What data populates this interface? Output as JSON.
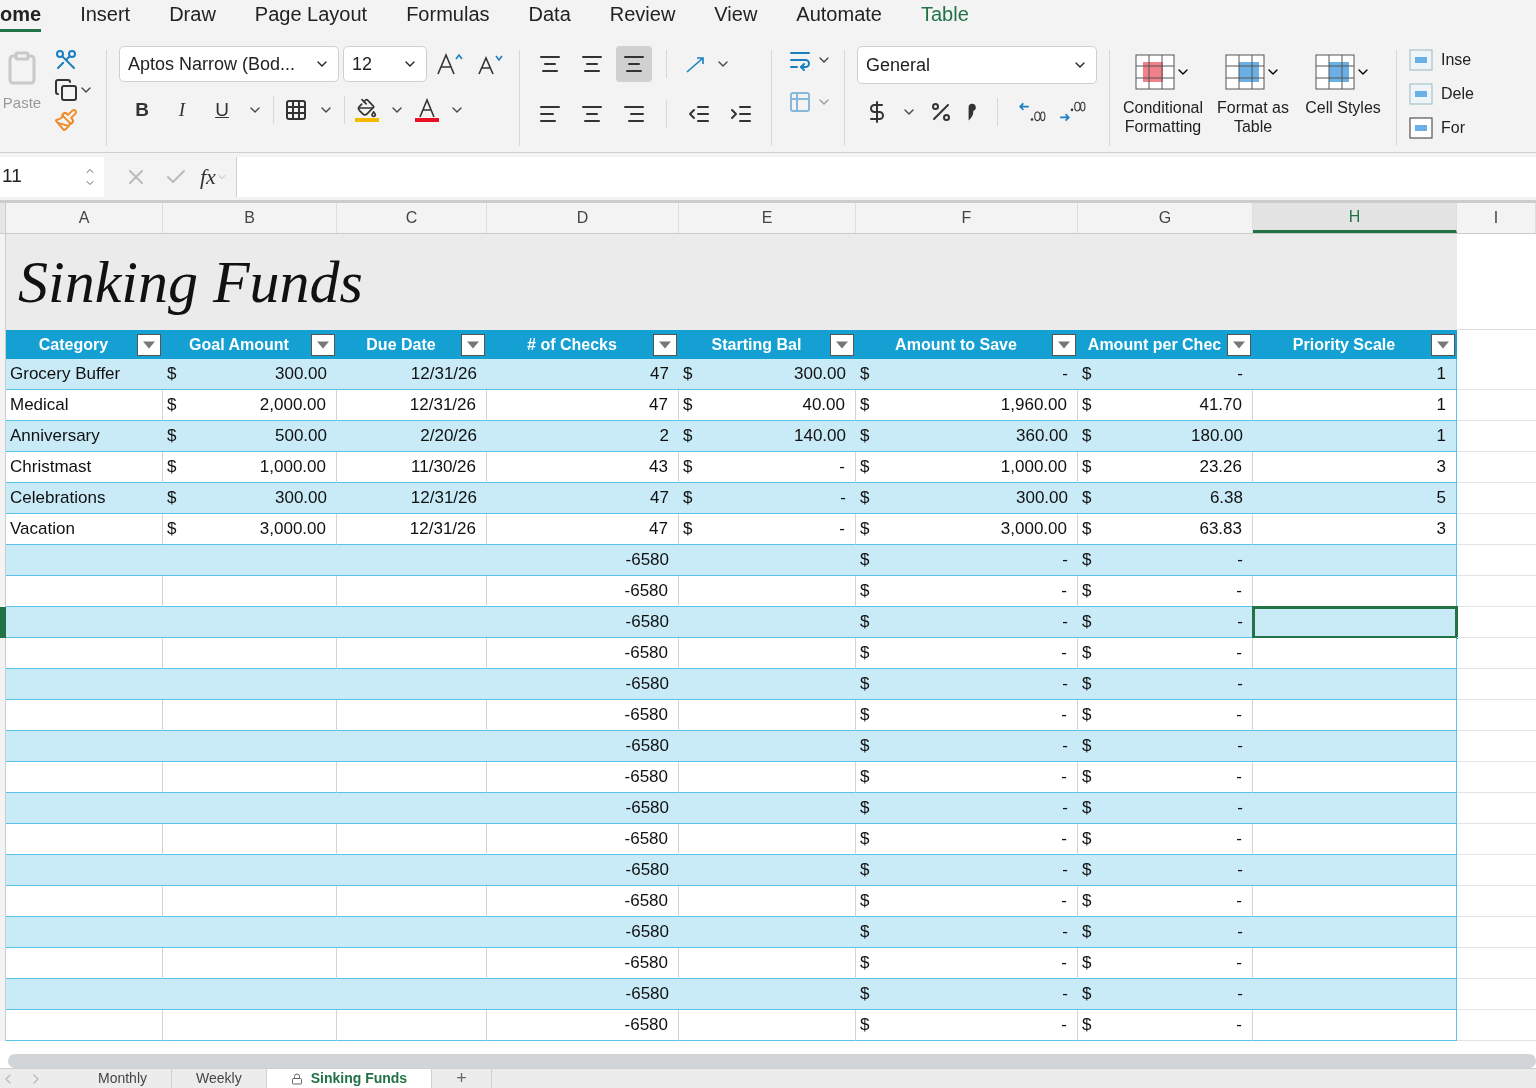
{
  "ribbon_tabs": [
    {
      "label": "ome",
      "selected": true,
      "kind": "normal"
    },
    {
      "label": "Insert",
      "selected": false,
      "kind": "normal"
    },
    {
      "label": "Draw",
      "selected": false,
      "kind": "normal"
    },
    {
      "label": "Page Layout",
      "selected": false,
      "kind": "normal"
    },
    {
      "label": "Formulas",
      "selected": false,
      "kind": "normal"
    },
    {
      "label": "Data",
      "selected": false,
      "kind": "normal"
    },
    {
      "label": "Review",
      "selected": false,
      "kind": "normal"
    },
    {
      "label": "View",
      "selected": false,
      "kind": "normal"
    },
    {
      "label": "Automate",
      "selected": false,
      "kind": "normal"
    },
    {
      "label": "Table",
      "selected": false,
      "kind": "contextual"
    }
  ],
  "ribbon": {
    "paste_label": "Paste",
    "font_name": "Aptos Narrow (Bod...",
    "font_size": "12",
    "number_format": "General",
    "bold": "B",
    "italic": "I",
    "underline": "U",
    "big_buttons": [
      "Conditional Formatting",
      "Format as Table",
      "Cell Styles"
    ],
    "cells_buttons": [
      "Inse",
      "Dele",
      "For"
    ]
  },
  "formula_bar": {
    "name_box": "11",
    "fx": "fx"
  },
  "column_letters": [
    {
      "label": "A",
      "selected": false
    },
    {
      "label": "B",
      "selected": false
    },
    {
      "label": "C",
      "selected": false
    },
    {
      "label": "D",
      "selected": false
    },
    {
      "label": "E",
      "selected": false
    },
    {
      "label": "F",
      "selected": false
    },
    {
      "label": "G",
      "selected": false
    },
    {
      "label": "H",
      "selected": true
    },
    {
      "label": "I",
      "selected": false
    }
  ],
  "sheet_title": "Sinking Funds",
  "table": {
    "columns": [
      "Category",
      "Goal Amount",
      "Due Date",
      "# of Checks",
      "Starting Bal",
      "Amount to Save",
      "Amount per Chec",
      "Priority Scale"
    ],
    "rows": [
      {
        "selected": false,
        "cells": [
          {
            "value": "Grocery Buffer"
          },
          {
            "currency": "$",
            "value": "300.00"
          },
          {
            "value": "12/31/26"
          },
          {
            "value": "47"
          },
          {
            "currency": "$",
            "value": "300.00"
          },
          {
            "currency": "$",
            "value": "-"
          },
          {
            "currency": "$",
            "value": "-"
          },
          {
            "value": "1"
          }
        ]
      },
      {
        "selected": false,
        "cells": [
          {
            "value": "Medical"
          },
          {
            "currency": "$",
            "value": "2,000.00"
          },
          {
            "value": "12/31/26"
          },
          {
            "value": "47"
          },
          {
            "currency": "$",
            "value": "40.00"
          },
          {
            "currency": "$",
            "value": "1,960.00"
          },
          {
            "currency": "$",
            "value": "41.70"
          },
          {
            "value": "1"
          }
        ]
      },
      {
        "selected": false,
        "cells": [
          {
            "value": "Anniversary"
          },
          {
            "currency": "$",
            "value": "500.00"
          },
          {
            "value": "2/20/26"
          },
          {
            "value": "2"
          },
          {
            "currency": "$",
            "value": "140.00"
          },
          {
            "currency": "$",
            "value": "360.00"
          },
          {
            "currency": "$",
            "value": "180.00"
          },
          {
            "value": "1"
          }
        ]
      },
      {
        "selected": false,
        "cells": [
          {
            "value": "Christmast"
          },
          {
            "currency": "$",
            "value": "1,000.00"
          },
          {
            "value": "11/30/26"
          },
          {
            "value": "43"
          },
          {
            "currency": "$",
            "value": "-"
          },
          {
            "currency": "$",
            "value": "1,000.00"
          },
          {
            "currency": "$",
            "value": "23.26"
          },
          {
            "value": "3"
          }
        ]
      },
      {
        "selected": false,
        "cells": [
          {
            "value": "Celebrations"
          },
          {
            "currency": "$",
            "value": "300.00"
          },
          {
            "value": "12/31/26"
          },
          {
            "value": "47"
          },
          {
            "currency": "$",
            "value": "-"
          },
          {
            "currency": "$",
            "value": "300.00"
          },
          {
            "currency": "$",
            "value": "6.38"
          },
          {
            "value": "5"
          }
        ]
      },
      {
        "selected": false,
        "cells": [
          {
            "value": "Vacation"
          },
          {
            "currency": "$",
            "value": "3,000.00"
          },
          {
            "value": "12/31/26"
          },
          {
            "value": "47"
          },
          {
            "currency": "$",
            "value": "-"
          },
          {
            "currency": "$",
            "value": "3,000.00"
          },
          {
            "currency": "$",
            "value": "63.83"
          },
          {
            "value": "3"
          }
        ]
      },
      {
        "selected": false,
        "cells": [
          {},
          {},
          {},
          {
            "value": "-6580"
          },
          {},
          {
            "currency": "$",
            "value": "-"
          },
          {
            "currency": "$",
            "value": "-"
          },
          {}
        ]
      },
      {
        "selected": false,
        "cells": [
          {},
          {},
          {},
          {
            "value": "-6580"
          },
          {},
          {
            "currency": "$",
            "value": "-"
          },
          {
            "currency": "$",
            "value": "-"
          },
          {}
        ]
      },
      {
        "selected": true,
        "cells": [
          {},
          {},
          {},
          {
            "value": "-6580"
          },
          {},
          {
            "currency": "$",
            "value": "-"
          },
          {
            "currency": "$",
            "value": "-"
          },
          {}
        ]
      },
      {
        "selected": false,
        "cells": [
          {},
          {},
          {},
          {
            "value": "-6580"
          },
          {},
          {
            "currency": "$",
            "value": "-"
          },
          {
            "currency": "$",
            "value": "-"
          },
          {}
        ]
      },
      {
        "selected": false,
        "cells": [
          {},
          {},
          {},
          {
            "value": "-6580"
          },
          {},
          {
            "currency": "$",
            "value": "-"
          },
          {
            "currency": "$",
            "value": "-"
          },
          {}
        ]
      },
      {
        "selected": false,
        "cells": [
          {},
          {},
          {},
          {
            "value": "-6580"
          },
          {},
          {
            "currency": "$",
            "value": "-"
          },
          {
            "currency": "$",
            "value": "-"
          },
          {}
        ]
      },
      {
        "selected": false,
        "cells": [
          {},
          {},
          {},
          {
            "value": "-6580"
          },
          {},
          {
            "currency": "$",
            "value": "-"
          },
          {
            "currency": "$",
            "value": "-"
          },
          {}
        ]
      },
      {
        "selected": false,
        "cells": [
          {},
          {},
          {},
          {
            "value": "-6580"
          },
          {},
          {
            "currency": "$",
            "value": "-"
          },
          {
            "currency": "$",
            "value": "-"
          },
          {}
        ]
      },
      {
        "selected": false,
        "cells": [
          {},
          {},
          {},
          {
            "value": "-6580"
          },
          {},
          {
            "currency": "$",
            "value": "-"
          },
          {
            "currency": "$",
            "value": "-"
          },
          {}
        ]
      },
      {
        "selected": false,
        "cells": [
          {},
          {},
          {},
          {
            "value": "-6580"
          },
          {},
          {
            "currency": "$",
            "value": "-"
          },
          {
            "currency": "$",
            "value": "-"
          },
          {}
        ]
      },
      {
        "selected": false,
        "cells": [
          {},
          {},
          {},
          {
            "value": "-6580"
          },
          {},
          {
            "currency": "$",
            "value": "-"
          },
          {
            "currency": "$",
            "value": "-"
          },
          {}
        ]
      },
      {
        "selected": false,
        "cells": [
          {},
          {},
          {},
          {
            "value": "-6580"
          },
          {},
          {
            "currency": "$",
            "value": "-"
          },
          {
            "currency": "$",
            "value": "-"
          },
          {}
        ]
      },
      {
        "selected": false,
        "cells": [
          {},
          {},
          {},
          {
            "value": "-6580"
          },
          {},
          {
            "currency": "$",
            "value": "-"
          },
          {
            "currency": "$",
            "value": "-"
          },
          {}
        ]
      },
      {
        "selected": false,
        "cells": [
          {},
          {},
          {},
          {
            "value": "-6580"
          },
          {},
          {
            "currency": "$",
            "value": "-"
          },
          {
            "currency": "$",
            "value": "-"
          },
          {}
        ]
      },
      {
        "selected": false,
        "cells": [
          {},
          {},
          {},
          {
            "value": "-6580"
          },
          {},
          {
            "currency": "$",
            "value": "-"
          },
          {
            "currency": "$",
            "value": "-"
          },
          {}
        ]
      },
      {
        "selected": false,
        "cells": [
          {},
          {},
          {},
          {
            "value": "-6580"
          },
          {},
          {
            "currency": "$",
            "value": "-"
          },
          {
            "currency": "$",
            "value": "-"
          },
          {}
        ]
      }
    ]
  },
  "sheet_tabs": [
    {
      "label": "Monthly",
      "selected": false
    },
    {
      "label": "Weekly",
      "selected": false
    },
    {
      "label": "Sinking Funds",
      "selected": true
    }
  ],
  "add_sheet": "+"
}
